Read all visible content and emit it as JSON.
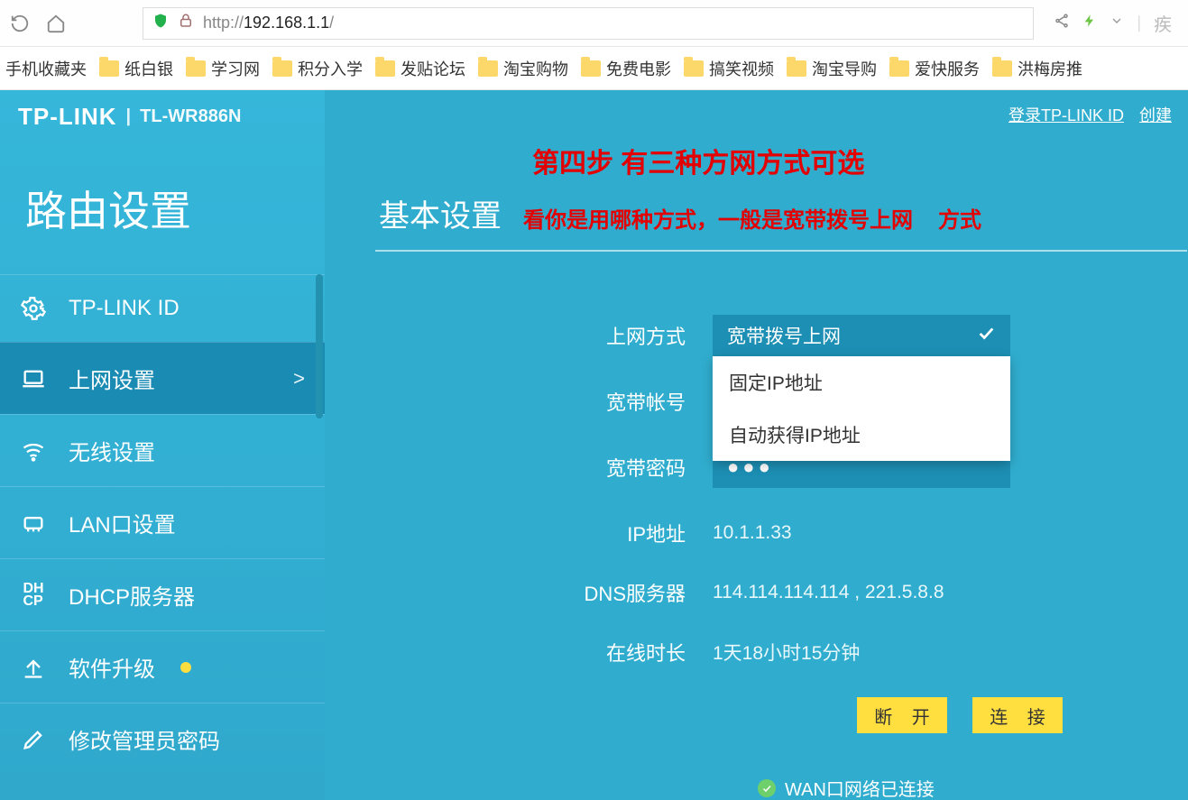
{
  "browser": {
    "url_prefix": "http://",
    "url_host": "192.168.1.1",
    "url_suffix": "/",
    "right_text": "疾"
  },
  "bookmarks": {
    "label0": "手机收藏夹",
    "items": [
      "纸白银",
      "学习网",
      "积分入学",
      "发贴论坛",
      "淘宝购物",
      "免费电影",
      "搞笑视频",
      "淘宝导购",
      "爱快服务",
      "洪梅房推"
    ]
  },
  "header": {
    "brand": "TP-LINK",
    "model": "TL-WR886N",
    "login_link": "登录TP-LINK ID",
    "create_link": "创建"
  },
  "sidebar": {
    "title": "路由设置",
    "items": [
      {
        "label": "TP-LINK ID"
      },
      {
        "label": "上网设置"
      },
      {
        "label": "无线设置"
      },
      {
        "label": "LAN口设置"
      },
      {
        "label": "DHCP服务器"
      },
      {
        "label": "软件升级"
      },
      {
        "label": "修改管理员密码"
      }
    ],
    "chev": ">"
  },
  "annot": {
    "step": "第四步  有三种方网方式可选",
    "sub1": "看你是用哪种方式，一般是宽带拨号上网",
    "sub2": "方式"
  },
  "main": {
    "section_title": "基本设置",
    "labels": {
      "method": "上网方式",
      "account": "宽带帐号",
      "password": "宽带密码",
      "ip": "IP地址",
      "dns": "DNS服务器",
      "online": "在线时长"
    },
    "method_selected": "宽带拨号上网",
    "method_options": [
      "固定IP地址",
      "自动获得IP地址"
    ],
    "password_mask": "●●●",
    "ip": "10.1.1.33",
    "dns": "114.114.114.114 , 221.5.8.8",
    "online": "1天18小时15分钟",
    "btn_disconnect": "断 开",
    "btn_connect": "连 接",
    "status": "WAN口网络已连接"
  }
}
